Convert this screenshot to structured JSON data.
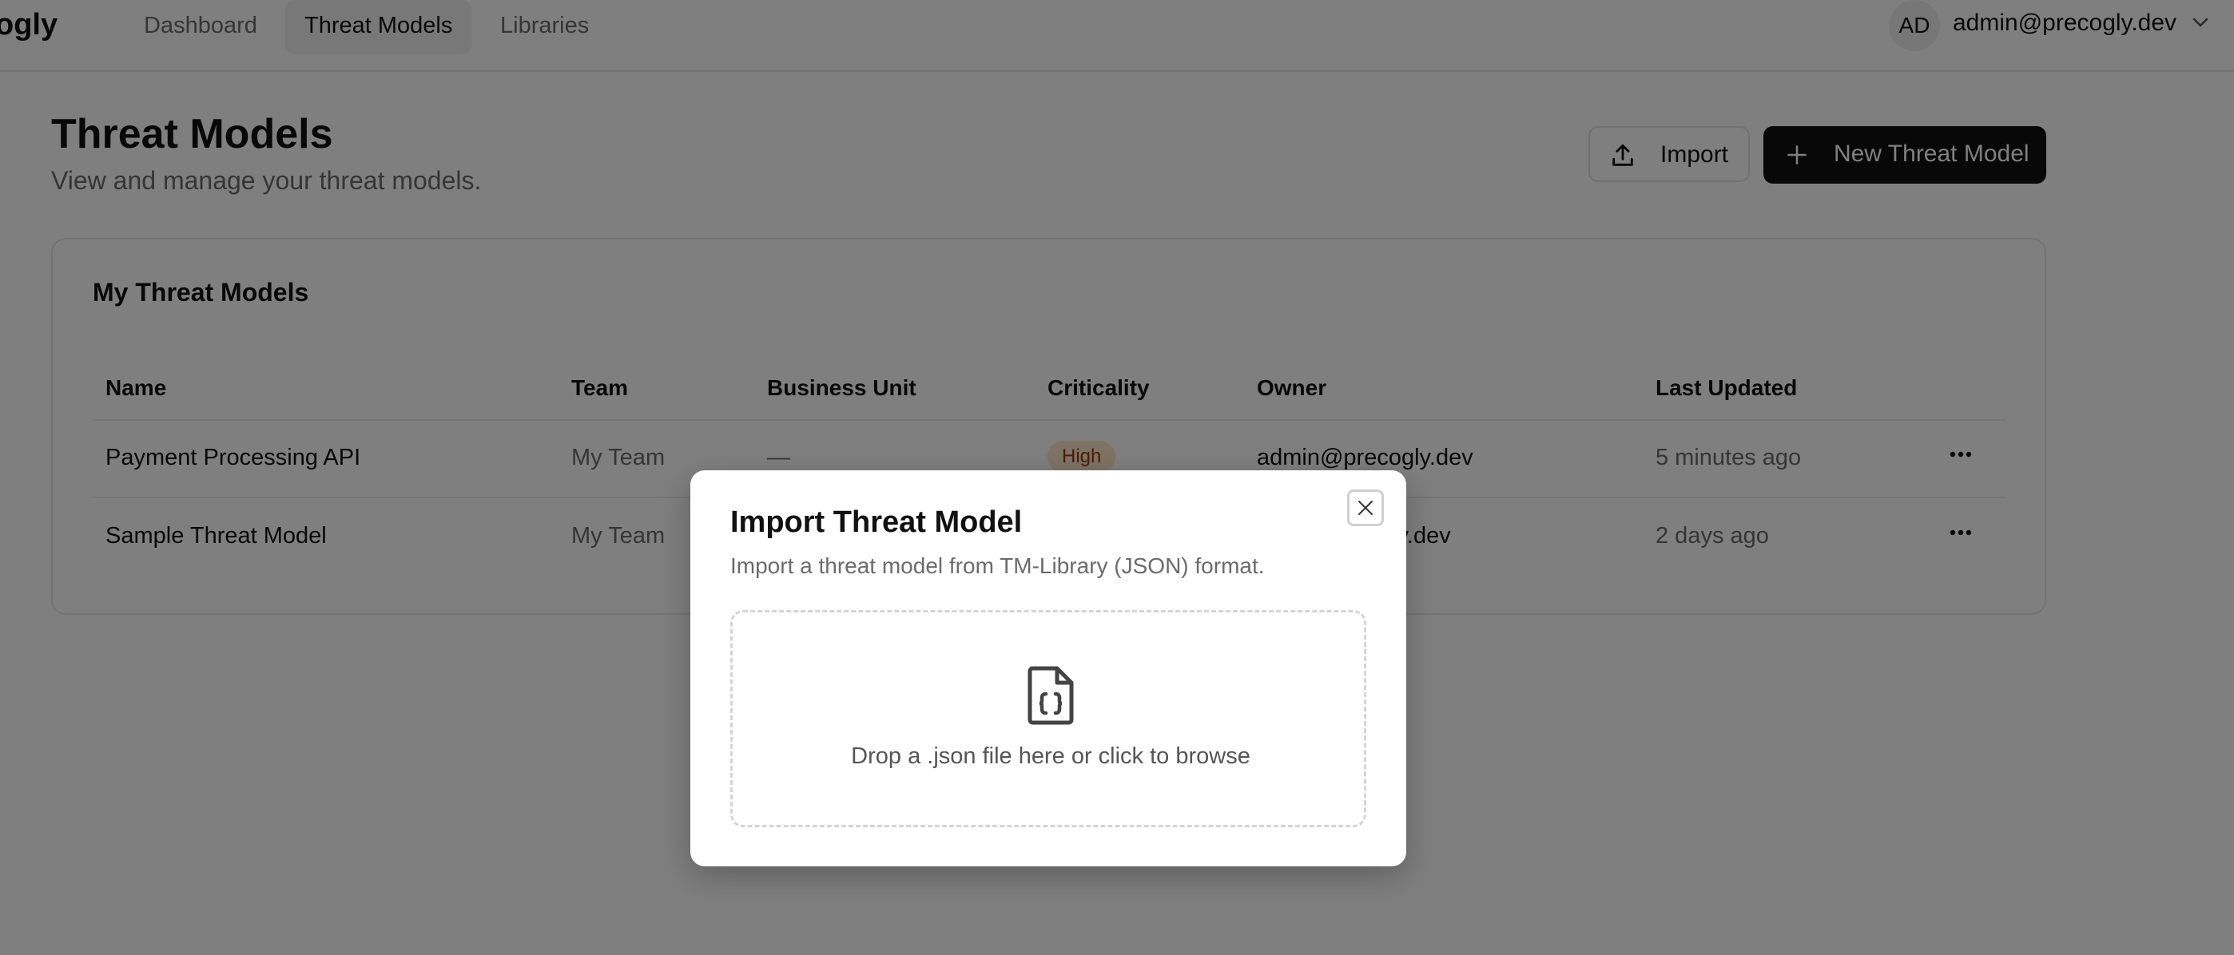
{
  "brand": {
    "name": "ogly"
  },
  "nav": {
    "tabs": [
      {
        "label": "Dashboard",
        "active": false
      },
      {
        "label": "Threat Models",
        "active": true
      },
      {
        "label": "Libraries",
        "active": false
      }
    ]
  },
  "user": {
    "initials": "AD",
    "email": "admin@precogly.dev",
    "menu_icon": "chevron-down-icon"
  },
  "page": {
    "title": "Threat Models",
    "subtitle": "View and manage your threat models."
  },
  "actions": {
    "import_label": "Import",
    "import_icon": "upload-icon",
    "new_label": "New Threat Model",
    "new_icon": "plus-icon"
  },
  "table": {
    "title": "My Threat Models",
    "columns": [
      "Name",
      "Team",
      "Business Unit",
      "Criticality",
      "Owner",
      "Last Updated"
    ],
    "rows": [
      {
        "name": "Payment Processing API",
        "team": "My Team",
        "business_unit": "—",
        "criticality": "High",
        "owner": "admin@precogly.dev",
        "updated": "5 minutes ago"
      },
      {
        "name": "Sample Threat Model",
        "team": "My Team",
        "business_unit": "",
        "criticality": "",
        "owner": "gly.dev",
        "updated": "2 days ago"
      }
    ]
  },
  "modal": {
    "title": "Import Threat Model",
    "description": "Import a threat model from TM-Library (JSON) format.",
    "dropzone_text": "Drop a .json file here or click to browse",
    "dropzone_icon": "json-file-icon",
    "close_icon": "close-icon"
  },
  "colors": {
    "primary": "#111111",
    "muted": "#6b6b6b",
    "badge_bg": "#fde7c8",
    "badge_text": "#9a3412",
    "overlay": "rgba(0,0,0,0.5)"
  }
}
